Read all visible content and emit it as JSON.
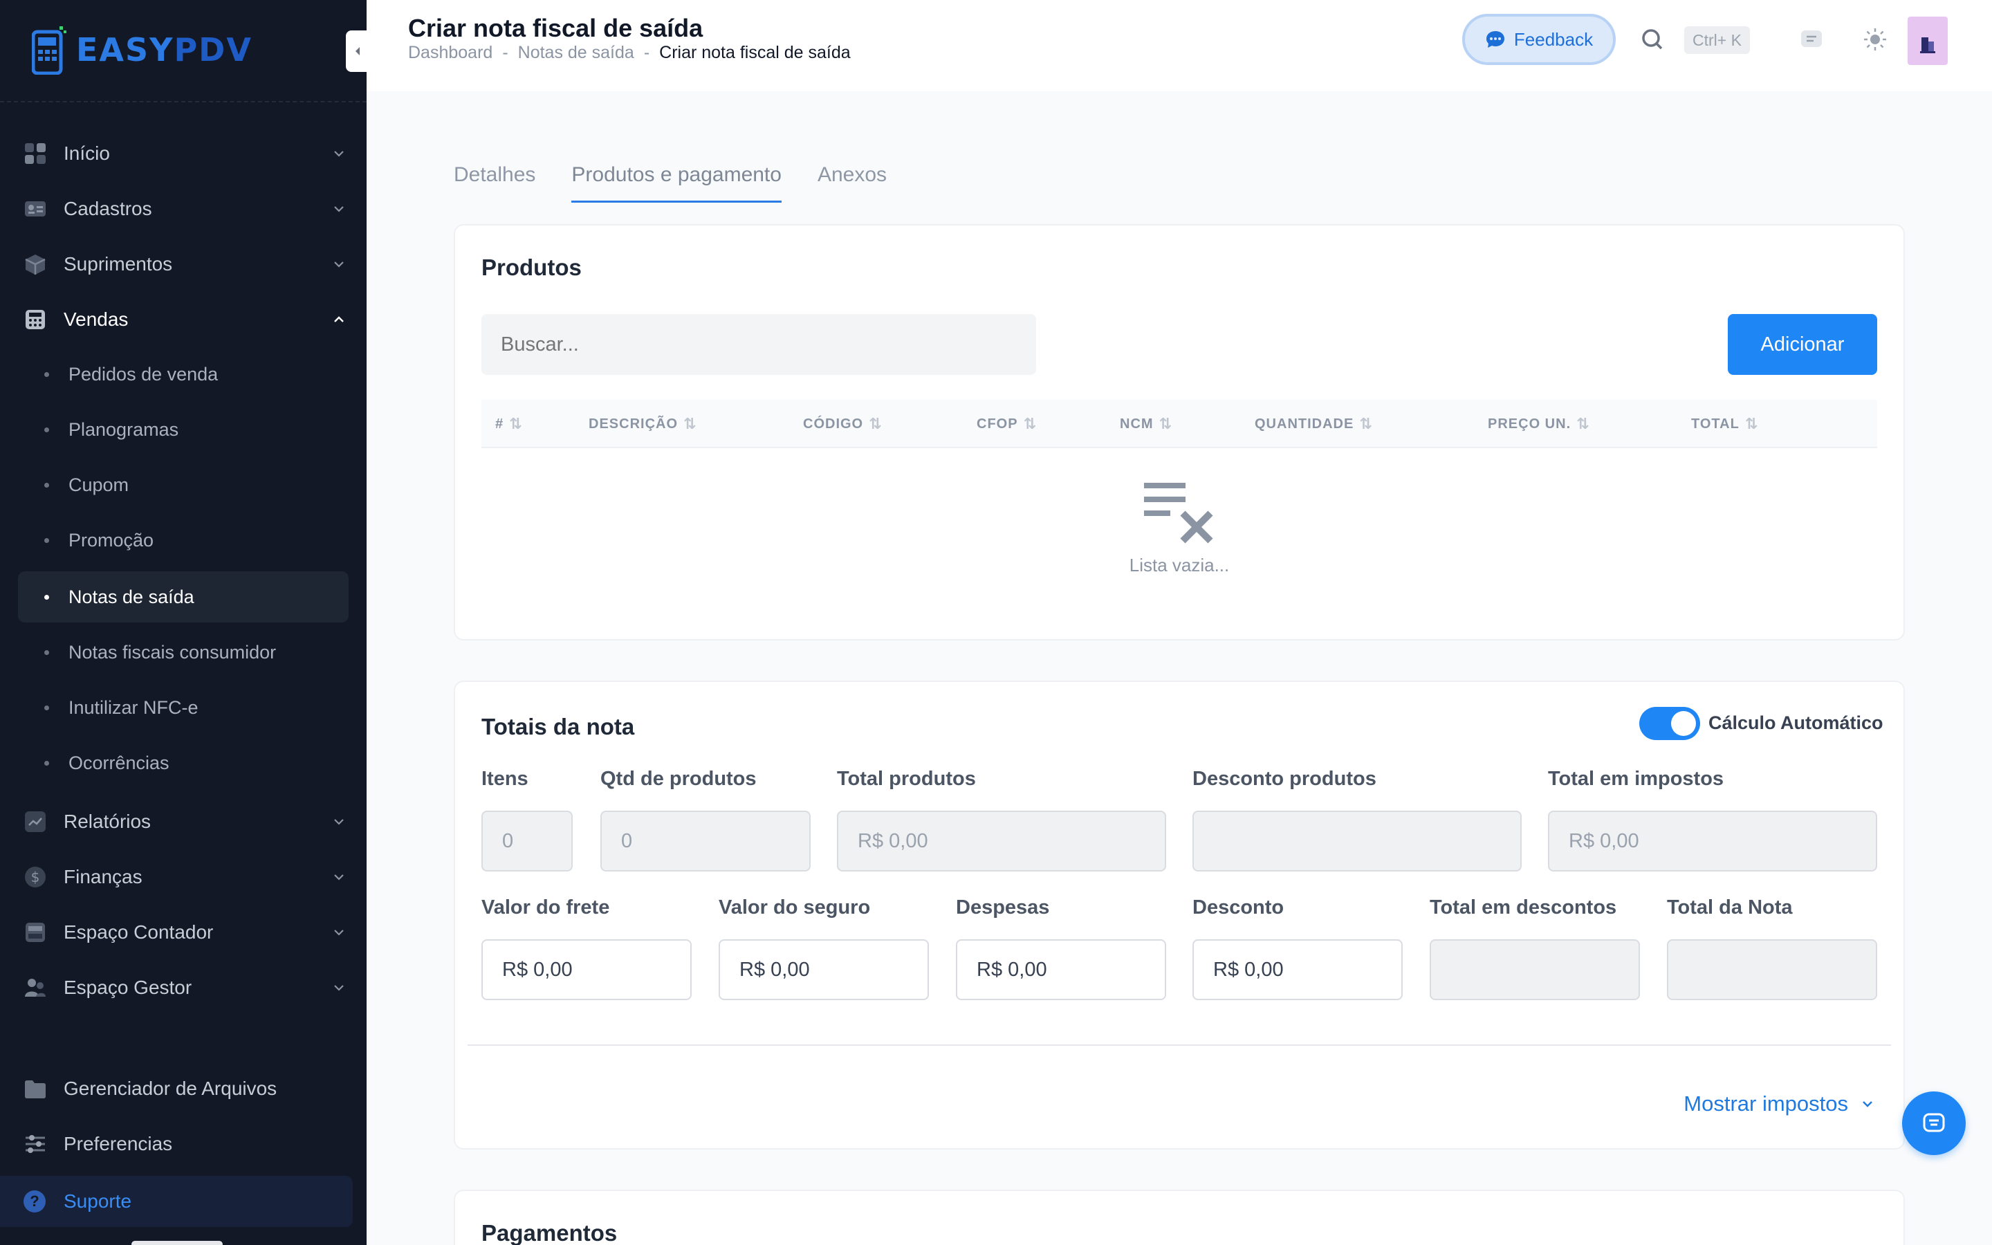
{
  "app": {
    "logo_left": "EASY",
    "logo_right": "PDV"
  },
  "sidebar": {
    "items": [
      {
        "label": "Início"
      },
      {
        "label": "Cadastros"
      },
      {
        "label": "Suprimentos"
      },
      {
        "label": "Vendas"
      },
      {
        "label": "Relatórios"
      },
      {
        "label": "Finanças"
      },
      {
        "label": "Espaço Contador"
      },
      {
        "label": "Espaço Gestor"
      },
      {
        "label": "Gerenciador de Arquivos"
      },
      {
        "label": "Preferencias"
      },
      {
        "label": "Suporte"
      }
    ],
    "sales_subitems": [
      {
        "label": "Pedidos de venda"
      },
      {
        "label": "Planogramas"
      },
      {
        "label": "Cupom"
      },
      {
        "label": "Promoção"
      },
      {
        "label": "Notas de saída"
      },
      {
        "label": "Notas fiscais consumidor"
      },
      {
        "label": "Inutilizar NFC-e"
      },
      {
        "label": "Ocorrências"
      }
    ]
  },
  "header": {
    "title": "Criar nota fiscal de saída",
    "breadcrumb": [
      "Dashboard",
      "Notas de saída",
      "Criar nota fiscal de saída"
    ],
    "breadcrumb_sep": "-",
    "feedback_label": "Feedback",
    "shortcut": "Ctrl+ K"
  },
  "tabs": [
    "Detalhes",
    "Produtos e pagamento",
    "Anexos"
  ],
  "products": {
    "title": "Produtos",
    "search_placeholder": "Buscar...",
    "add_label": "Adicionar",
    "columns": [
      "#",
      "DESCRIÇÃO",
      "CÓDIGO",
      "CFOP",
      "NCM",
      "QUANTIDADE",
      "PREÇO UN.",
      "TOTAL"
    ],
    "empty_text": "Lista vazia..."
  },
  "totals": {
    "title": "Totais da nota",
    "auto_calc_label": "Cálculo Automático",
    "auto_calc_on": true,
    "row1": [
      {
        "label": "Itens",
        "value": "0"
      },
      {
        "label": "Qtd de produtos",
        "value": "0"
      },
      {
        "label": "Total produtos",
        "value": "R$ 0,00"
      },
      {
        "label": "Desconto produtos",
        "value": ""
      },
      {
        "label": "Total em impostos",
        "value": "R$ 0,00"
      }
    ],
    "row2": [
      {
        "label": "Valor do frete",
        "value": "R$ 0,00"
      },
      {
        "label": "Valor do seguro",
        "value": "R$ 0,00"
      },
      {
        "label": "Despesas",
        "value": "R$ 0,00"
      },
      {
        "label": "Desconto",
        "value": "R$ 0,00"
      },
      {
        "label": "Total em descontos",
        "value": ""
      },
      {
        "label": "Total da Nota",
        "value": ""
      }
    ],
    "show_taxes_label": "Mostrar impostos"
  },
  "payments": {
    "title": "Pagamentos"
  },
  "colors": {
    "accent": "#1f87f5",
    "sidebar_bg": "#121826",
    "support_text": "#3b8df6"
  }
}
